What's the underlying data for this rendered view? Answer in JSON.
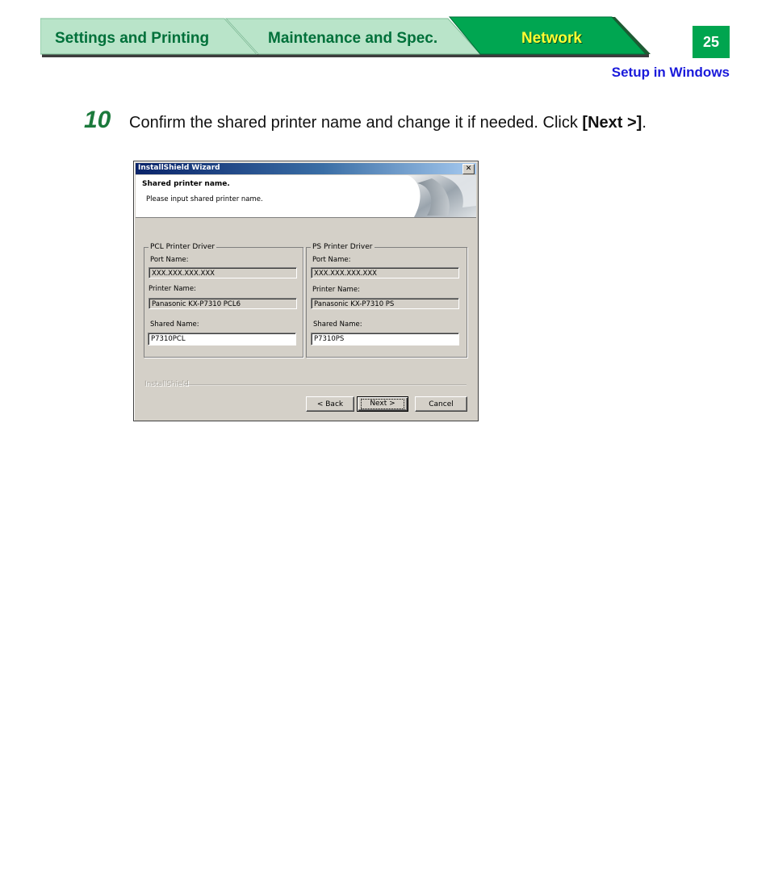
{
  "tabs": {
    "settings": "Settings and Printing",
    "maintenance": "Maintenance and Spec.",
    "network": "Network"
  },
  "page_number": "25",
  "section_link": "Setup in Windows",
  "step": {
    "number": "10",
    "text": "Confirm the shared printer name and change it if needed. Click ",
    "bold": "[Next >]",
    "end": "."
  },
  "dialog": {
    "title": "InstallShield Wizard",
    "close_glyph": "✕",
    "header_title": "Shared printer name.",
    "header_subtitle": "Please input shared printer name.",
    "pcl": {
      "group_label": "PCL Printer Driver",
      "port_label": "Port Name:",
      "port_value": "XXX.XXX.XXX.XXX",
      "printer_label": "Printer Name:",
      "printer_value": "Panasonic KX-P7310 PCL6",
      "shared_label": "Shared Name:",
      "shared_value": "P7310PCL"
    },
    "ps": {
      "group_label": "PS Printer Driver",
      "port_label": "Port Name:",
      "port_value": "XXX.XXX.XXX.XXX",
      "printer_label": "Printer Name:",
      "printer_value": "Panasonic KX-P7310 PS",
      "shared_label": "Shared Name:",
      "shared_value": "P7310PS"
    },
    "brand": "InstallShield",
    "buttons": {
      "back": "< Back",
      "next": "Next >",
      "cancel": "Cancel"
    }
  },
  "colors": {
    "tab_green_light": "#b7e2c6",
    "tab_green_active": "#00a54f",
    "tab_text": "#00703a",
    "active_tab_text": "#ffff33",
    "link_blue": "#1a1adb",
    "step_green": "#1c7a3c"
  }
}
